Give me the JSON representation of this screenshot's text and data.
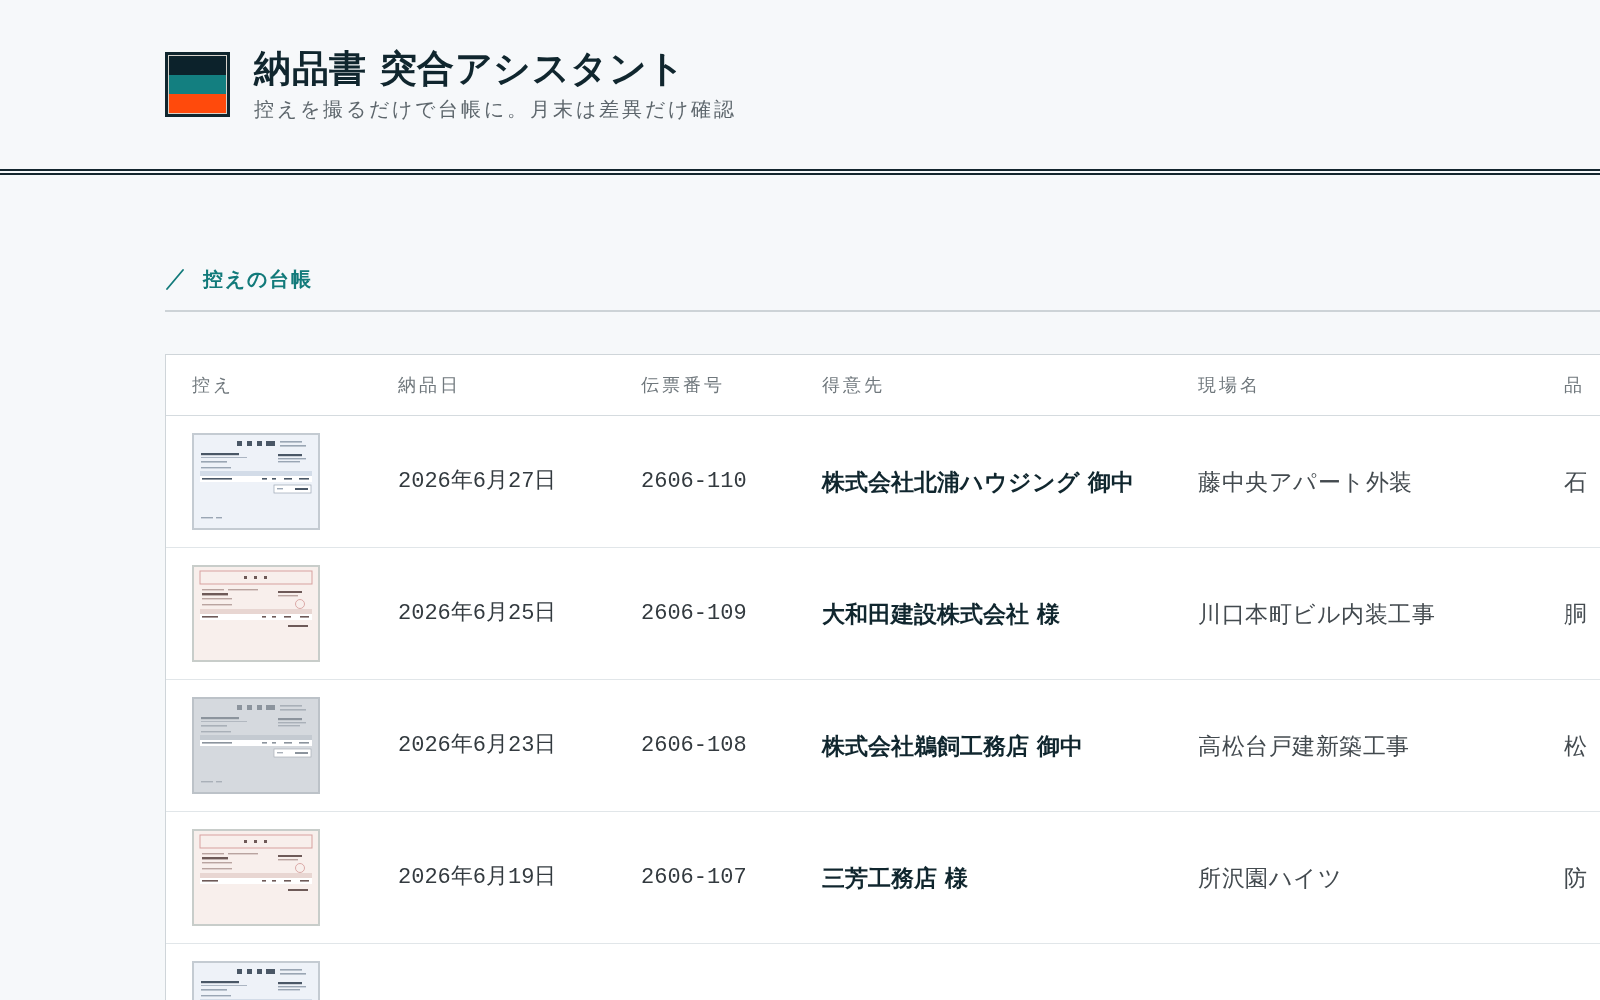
{
  "app": {
    "title": "納品書 突合アシスタント",
    "tagline": "控えを撮るだけで台帳に。月末は差異だけ確認"
  },
  "section": {
    "title": "控えの台帳"
  },
  "table": {
    "columns": [
      "控え",
      "納品日",
      "伝票番号",
      "得意先",
      "現場名",
      "品"
    ],
    "rows": [
      {
        "copy": {
          "kind": "note"
        },
        "date": "2026年6月27日",
        "slip_no": "2606-110",
        "customer": "株式会社北浦ハウジング 御中",
        "site": "藤中央アパート外装",
        "item": "石"
      },
      {
        "copy": {
          "kind": "receipt"
        },
        "date": "2026年6月25日",
        "slip_no": "2606-109",
        "customer": "大和田建設株式会社 様",
        "site": "川口本町ビル内装工事",
        "item": "胴"
      },
      {
        "copy": {
          "kind": "dim"
        },
        "date": "2026年6月23日",
        "slip_no": "2606-108",
        "customer": "株式会社鵜飼工務店 御中",
        "site": "高松台戸建新築工事",
        "item": "松"
      },
      {
        "copy": {
          "kind": "receipt"
        },
        "date": "2026年6月19日",
        "slip_no": "2606-107",
        "customer": "三芳工務店 様",
        "site": "所沢園ハイツ",
        "item": "防"
      },
      {
        "copy": {
          "kind": "note"
        }
      }
    ]
  }
}
